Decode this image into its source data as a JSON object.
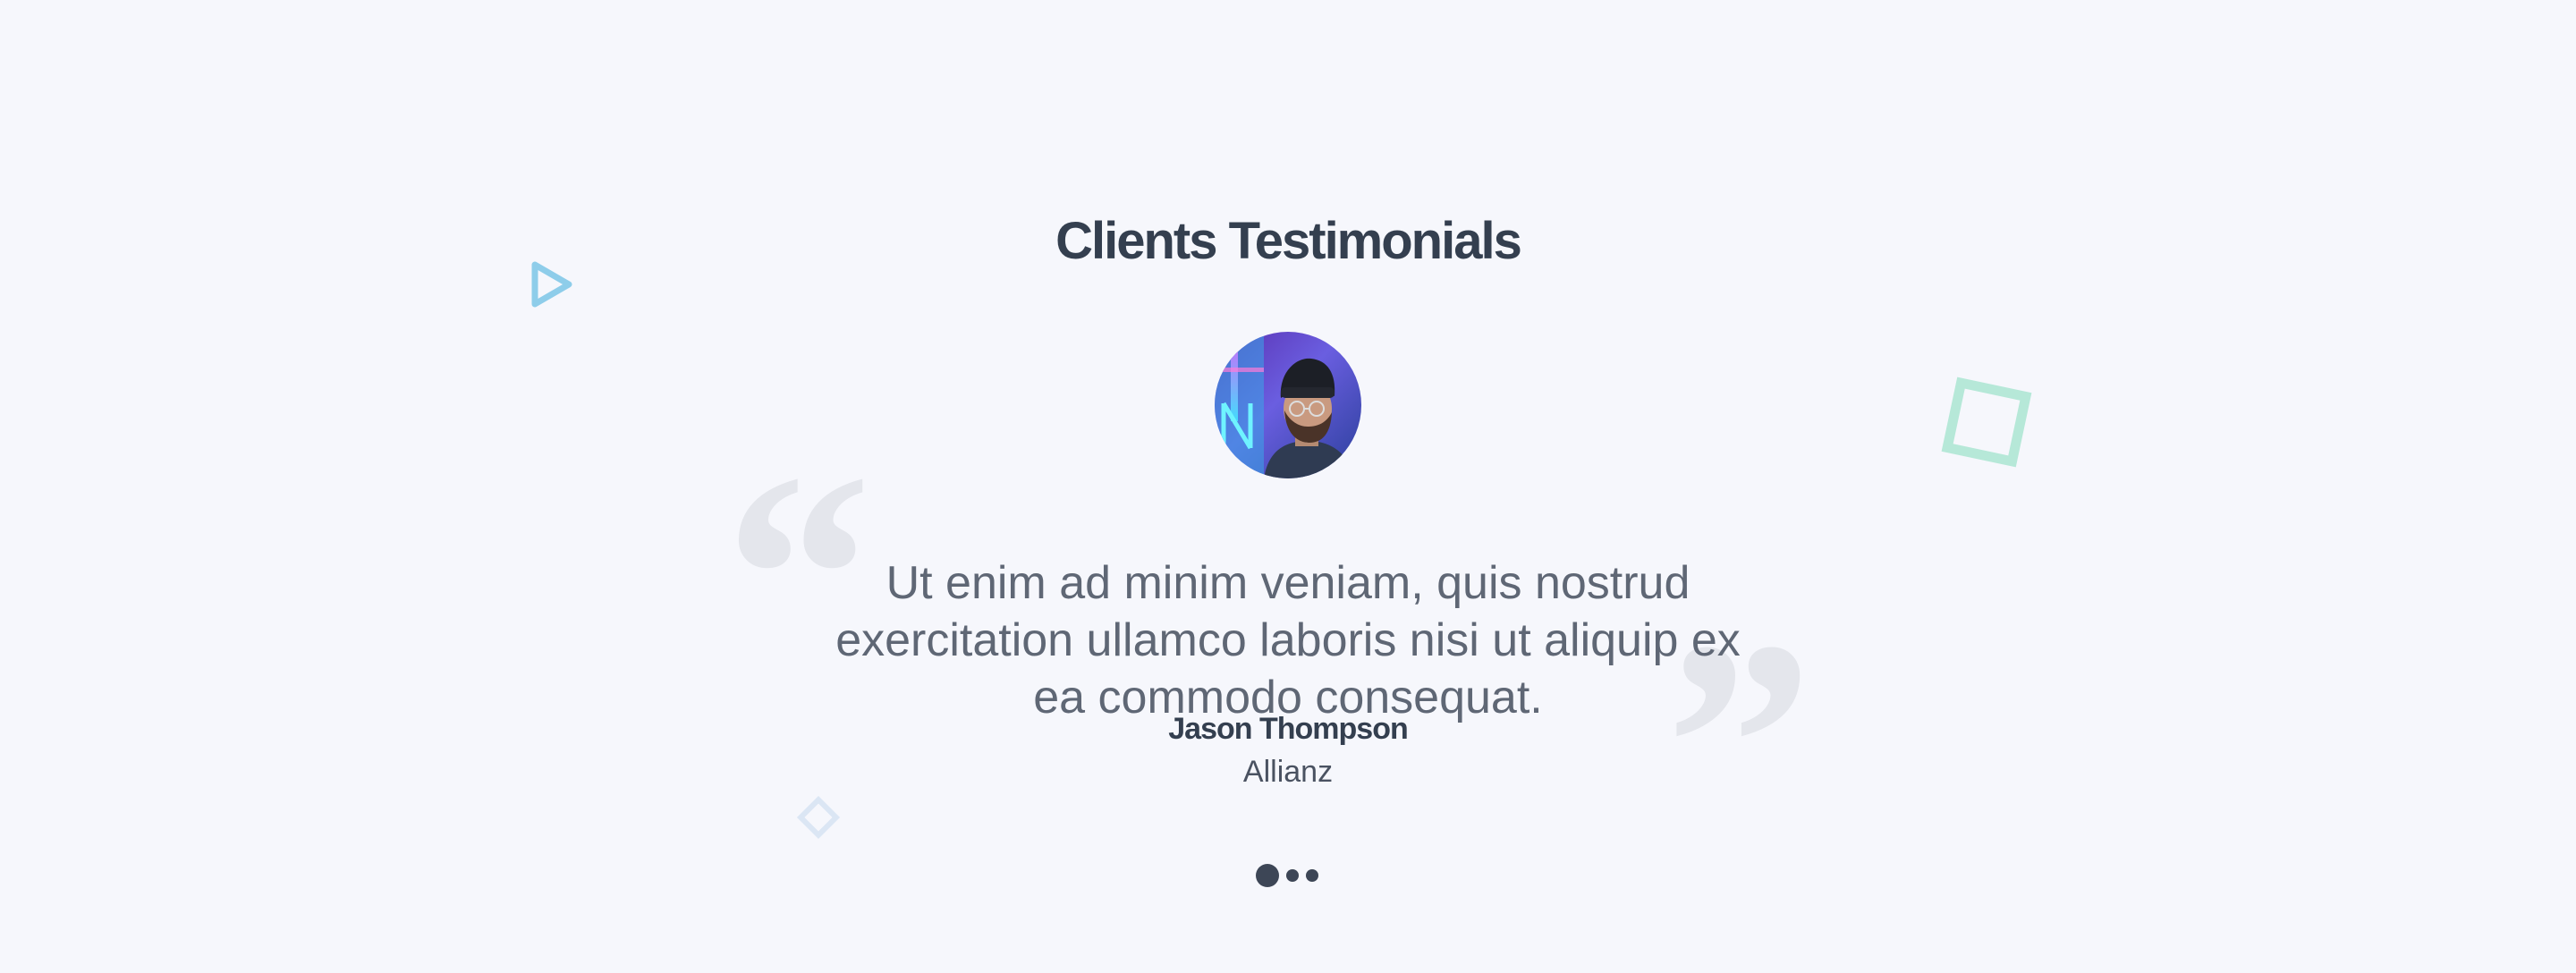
{
  "section": {
    "title": "Clients Testimonials"
  },
  "testimonial": {
    "quote": "Ut enim ad minim veniam, quis nostrud\nexercitation ullamco laboris nisi ut aliquip ex\nea commodo consequat.",
    "author_name": "Jason Thompson",
    "author_company": "Allianz",
    "avatar_icon": "person-avatar-photo"
  },
  "quote_marks": {
    "open": "“",
    "close": "”"
  },
  "carousel": {
    "slide_count": 3,
    "active_index": 0
  },
  "decorations": {
    "triangle_color": "#8ecdea",
    "square_color": "#b6e8d8",
    "diamond_color": "#dbe6f4"
  },
  "colors": {
    "background": "#f6f7fc",
    "heading": "#343f4f",
    "body_text": "#5f6775",
    "quote_marks": "#e4e6ec"
  }
}
